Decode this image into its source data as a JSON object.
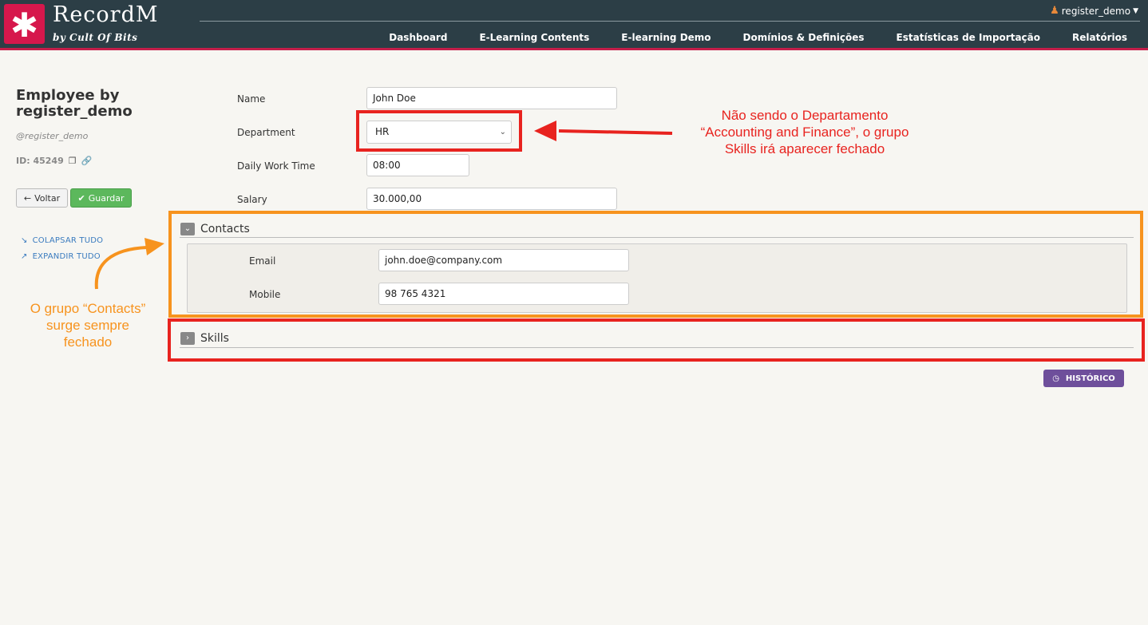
{
  "header": {
    "logo_glyph": "✱",
    "brand": "RecordM",
    "brand_sub": "by Cult Of Bits",
    "user": "register_demo",
    "nav": [
      "Dashboard",
      "E-Learning Contents",
      "E-learning Demo",
      "Domínios & Definições",
      "Estatísticas de Importação",
      "Relatórios"
    ]
  },
  "sidebar": {
    "title": "Employee by register_demo",
    "handle": "@register_demo",
    "id_label": "ID: 45249",
    "back_label": "Voltar",
    "save_label": "Guardar",
    "collapse_label": "COLAPSAR TUDO",
    "expand_label": "EXPANDIR TUDO"
  },
  "form": {
    "name_label": "Name",
    "name_value": "John Doe",
    "department_label": "Department",
    "department_value": "HR",
    "work_time_label": "Daily Work Time",
    "work_time_value": "08:00",
    "salary_label": "Salary",
    "salary_value": "30.000,00"
  },
  "contacts": {
    "title": "Contacts",
    "email_label": "Email",
    "email_value": "john.doe@company.com",
    "mobile_label": "Mobile",
    "mobile_value": "98 765 4321"
  },
  "skills": {
    "title": "Skills"
  },
  "history_label": "HISTÓRICO",
  "annotations": {
    "red_note_line1": "Não sendo o Departamento",
    "red_note_line2": "“Accounting and Finance”, o grupo",
    "red_note_line3": "Skills irá aparecer fechado",
    "orange_note_line1": "O grupo “Contacts”",
    "orange_note_line2": "surge sempre",
    "orange_note_line3": "fechado"
  },
  "colors": {
    "header_bg": "#2c3e46",
    "accent": "#c41e4a",
    "save_green": "#5cb85c",
    "history_purple": "#6e4f9b",
    "annotation_red": "#e8231f",
    "annotation_orange": "#f7931e"
  }
}
